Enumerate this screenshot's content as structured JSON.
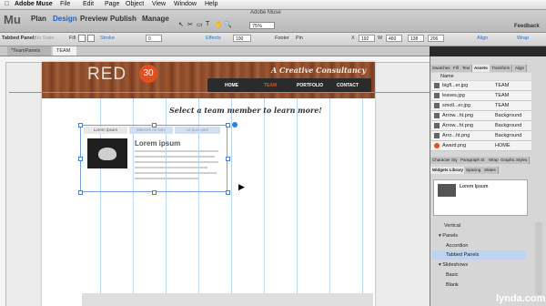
{
  "os_menu": {
    "apple": "",
    "app_name": "Adobe Muse",
    "items": [
      "File",
      "Edit",
      "Page",
      "Object",
      "View",
      "Window",
      "Help"
    ]
  },
  "app": {
    "window_title": "Adobe Muse",
    "logo": "Mu",
    "modes": [
      "Plan",
      "Design",
      "Preview",
      "Publish",
      "Manage"
    ],
    "active_mode": "Design",
    "zoom": "75%",
    "feedback": "Feedback"
  },
  "control_bar": {
    "selection_label": "Tabbed Panel:",
    "state_placeholder": "No State",
    "fill": "Fill",
    "stroke": "Stroke",
    "stroke_value": "0",
    "effects": "Effects",
    "opacity": "100",
    "footer": "Footer",
    "pin": "Pin",
    "x_label": "X",
    "x": "192",
    "w_label": "W",
    "w": "460",
    "y": "138",
    "h": "206",
    "align": "Align",
    "wrap": "Wrap"
  },
  "doc_tabs": [
    "*TeamPanels",
    "TEAM"
  ],
  "website": {
    "logo_text": "RED",
    "logo_badge": "30",
    "tagline": "A Creative Consultancy",
    "nav": [
      "HOME",
      "TEAM",
      "PORTFOLIO",
      "CONTACT"
    ],
    "active_nav": "TEAM",
    "headline": "Select a team member to learn more!",
    "panel_tabs": [
      "Lorem Ipsum",
      "Maecen mi sem",
      "Ut quis ante"
    ],
    "panel_title": "Lorem ipsum"
  },
  "panel": {
    "top_tabs": [
      "Swatches",
      "Fill",
      "Text",
      "Assets",
      "Transform",
      "Align"
    ],
    "active_top_tab": "Assets",
    "assets_header": {
      "name": "Name"
    },
    "assets": [
      {
        "name": "bigfl...er.jpg",
        "page": "TEAM"
      },
      {
        "name": "leaves.jpg",
        "page": "TEAM"
      },
      {
        "name": "smoll...er.jpg",
        "page": "TEAM"
      },
      {
        "name": "Arrow...ht.png",
        "page": "Background"
      },
      {
        "name": "Arrow...ht.png",
        "page": "Background"
      },
      {
        "name": "Arro...ht.png",
        "page": "Background"
      },
      {
        "name": "Award.png",
        "page": "HOME"
      }
    ],
    "mid_tabs": [
      "Character Sty",
      "Paragraph St",
      "Wrap",
      "Graphic Styles"
    ],
    "lower_tabs": [
      "Widgets Library",
      "Spacing",
      "States"
    ],
    "active_lower_tab": "Widgets Library",
    "widget_preview_title": "Lorem Ipsum",
    "widgets": [
      {
        "label": "Vertical",
        "type": "item"
      },
      {
        "label": "Panels",
        "type": "group"
      },
      {
        "label": "Accordion",
        "type": "item"
      },
      {
        "label": "Tabbed Panels",
        "type": "item",
        "selected": true
      },
      {
        "label": "Slideshows",
        "type": "group"
      },
      {
        "label": "Basic",
        "type": "item"
      },
      {
        "label": "Blank",
        "type": "item"
      }
    ]
  },
  "watermark": "lynda.com"
}
